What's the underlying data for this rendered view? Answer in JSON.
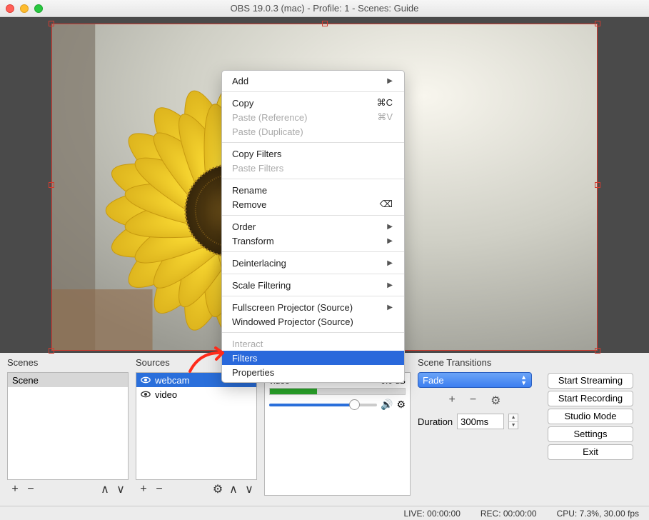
{
  "window_title": "OBS 19.0.3 (mac) - Profile: 1 - Scenes: Guide",
  "panels": {
    "scenes_label": "Scenes",
    "sources_label": "Sources",
    "transitions_label": "Scene Transitions"
  },
  "scenes": [
    "Scene"
  ],
  "sources": [
    "webcam",
    "video"
  ],
  "mixer": {
    "source": "video",
    "level": "0.0 dB"
  },
  "transitions": {
    "selected": "Fade",
    "duration_label": "Duration",
    "duration_value": "300ms"
  },
  "controls": {
    "start_streaming": "Start Streaming",
    "start_recording": "Start Recording",
    "studio_mode": "Studio Mode",
    "settings": "Settings",
    "exit": "Exit"
  },
  "statusbar": {
    "live": "LIVE: 00:00:00",
    "rec": "REC: 00:00:00",
    "cpu": "CPU: 7.3%, 30.00 fps"
  },
  "context_menu": {
    "add": "Add",
    "copy": "Copy",
    "copy_sc": "⌘C",
    "paste_ref": "Paste (Reference)",
    "paste_sc": "⌘V",
    "paste_dup": "Paste (Duplicate)",
    "copy_filters": "Copy Filters",
    "paste_filters": "Paste Filters",
    "rename": "Rename",
    "remove": "Remove",
    "remove_sc": "⌫",
    "order": "Order",
    "transform": "Transform",
    "deinterlacing": "Deinterlacing",
    "scale_filtering": "Scale Filtering",
    "fullscreen_proj": "Fullscreen Projector (Source)",
    "windowed_proj": "Windowed Projector (Source)",
    "interact": "Interact",
    "filters": "Filters",
    "properties": "Properties"
  }
}
